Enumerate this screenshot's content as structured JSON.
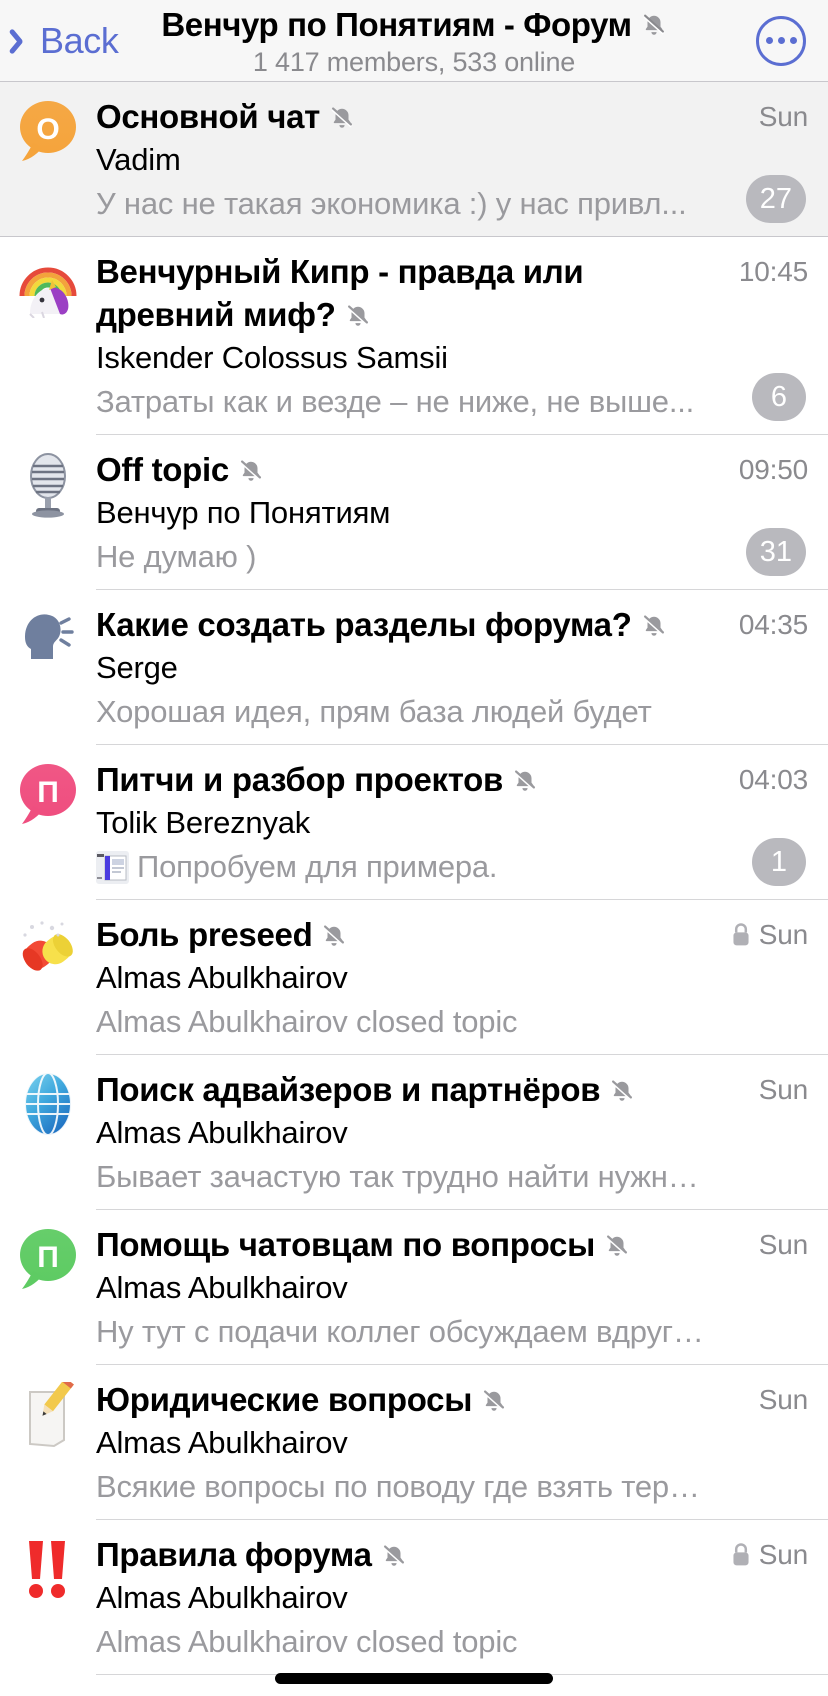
{
  "header": {
    "back_label": "Back",
    "title": "Венчур по Понятиям - Форум",
    "subtitle": "1 417 members, 533 online",
    "more_icon": "more-dots-icon",
    "mute_icon": "muted-bell-icon",
    "accent_color": "#5b6ed2"
  },
  "topics": [
    {
      "avatar_icon": "orange-bubble-avatar",
      "avatar_letter": "О",
      "avatar_color": "#f5a43c",
      "title": "Основной чат",
      "muted": true,
      "sender": "Vadim",
      "preview": "У нас не такая экономика :) у нас привл...",
      "time": "Sun",
      "badge": "27",
      "locked": false,
      "pinned": true,
      "thumb": false
    },
    {
      "avatar_icon": "unicorn-rainbow-emoji",
      "avatar_letter": "",
      "avatar_color": "",
      "title": "Венчурный Кипр - правда или древний миф?",
      "muted": true,
      "sender": "Iskender Colossus Samsii",
      "preview": "Затраты как и везде – не ниже, не выше...",
      "time": "10:45",
      "badge": "6",
      "locked": false,
      "pinned": false,
      "thumb": false
    },
    {
      "avatar_icon": "studio-microphone-emoji",
      "avatar_letter": "",
      "avatar_color": "",
      "title": "Off topic",
      "muted": true,
      "sender": "Венчур по Понятиям",
      "preview": "Не думаю )",
      "time": "09:50",
      "badge": "31",
      "locked": false,
      "pinned": false,
      "thumb": false
    },
    {
      "avatar_icon": "speaking-head-emoji",
      "avatar_letter": "",
      "avatar_color": "",
      "title": "Какие создать разделы форума?",
      "muted": true,
      "sender": "Serge",
      "preview": "Хорошая идея, прям база людей будет",
      "time": "04:35",
      "badge": "",
      "locked": false,
      "pinned": false,
      "thumb": false
    },
    {
      "avatar_icon": "pink-bubble-avatar",
      "avatar_letter": "П",
      "avatar_color": "#ef4e7f",
      "title": "Питчи и разбор проектов",
      "muted": true,
      "sender": "Tolik Bereznyak",
      "preview": "Попробуем для примера.",
      "time": "04:03",
      "badge": "1",
      "locked": false,
      "pinned": false,
      "thumb": true
    },
    {
      "avatar_icon": "pill-emoji",
      "avatar_letter": "",
      "avatar_color": "",
      "title": "Боль preseed",
      "muted": true,
      "sender": "Almas Abulkhairov",
      "preview": "Almas Abulkhairov closed topic",
      "time": "Sun",
      "badge": "",
      "locked": true,
      "pinned": false,
      "thumb": false
    },
    {
      "avatar_icon": "globe-emoji",
      "avatar_letter": "",
      "avatar_color": "",
      "title": "Поиск адвайзеров и партнёров",
      "muted": true,
      "sender": "Almas Abulkhairov",
      "preview": "Бывает зачастую так трудно найти нужного...",
      "time": "Sun",
      "badge": "",
      "locked": false,
      "pinned": false,
      "thumb": false
    },
    {
      "avatar_icon": "green-bubble-avatar",
      "avatar_letter": "П",
      "avatar_color": "#5ecb63",
      "title": "Помощь чатовцам по вопросы",
      "muted": true,
      "sender": "Almas Abulkhairov",
      "preview": "Ну тут с подачи коллег обсуждаем вдруг у в...",
      "time": "Sun",
      "badge": "",
      "locked": false,
      "pinned": false,
      "thumb": false
    },
    {
      "avatar_icon": "memo-emoji",
      "avatar_letter": "",
      "avatar_color": "",
      "title": "Юридические вопросы",
      "muted": true,
      "sender": "Almas Abulkhairov",
      "preview": "Всякие вопросы по поводу где взять термш...",
      "time": "Sun",
      "badge": "",
      "locked": false,
      "pinned": false,
      "thumb": false
    },
    {
      "avatar_icon": "double-exclamation-emoji",
      "avatar_letter": "",
      "avatar_color": "",
      "title": "Правила форума",
      "muted": true,
      "sender": "Almas Abulkhairov",
      "preview": "Almas Abulkhairov closed topic",
      "time": "Sun",
      "badge": "",
      "locked": true,
      "pinned": false,
      "thumb": false
    }
  ]
}
